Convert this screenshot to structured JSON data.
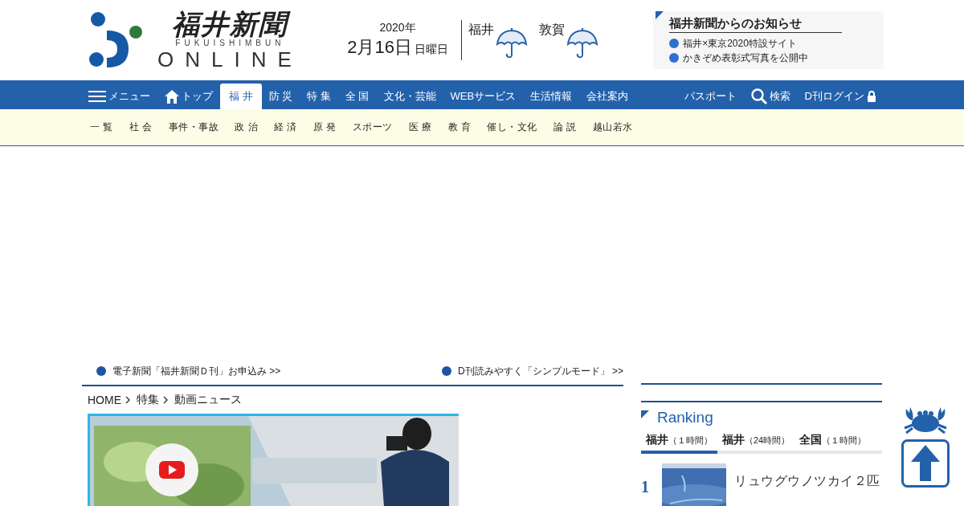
{
  "logo": {
    "title": "福井新聞",
    "subtitle": "FUKUISHIMBUN",
    "wordmark": "ONLINE"
  },
  "date": {
    "year": "2020年",
    "day": "2月16日",
    "weekday": "日曜日"
  },
  "weather": [
    {
      "city": "福井",
      "kind": "rain"
    },
    {
      "city": "敦賀",
      "kind": "rain"
    }
  ],
  "notices": {
    "title": "福井新聞からのお知らせ",
    "items": [
      "福井×東京2020特設サイト",
      "かきぞめ表彰式写真を公開中"
    ]
  },
  "nav": {
    "menu": "メニュー",
    "items": [
      {
        "label": "トップ",
        "kind": "home",
        "selected": false
      },
      {
        "label": "福 井",
        "kind": "text",
        "selected": true
      },
      {
        "label": "防 災",
        "kind": "text",
        "selected": false
      },
      {
        "label": "特 集",
        "kind": "text",
        "selected": false
      },
      {
        "label": "全 国",
        "kind": "text",
        "selected": false
      },
      {
        "label": "文化・芸能",
        "kind": "text",
        "selected": false
      },
      {
        "label": "WEBサービス",
        "kind": "text",
        "selected": false
      },
      {
        "label": "生活情報",
        "kind": "text",
        "selected": false
      },
      {
        "label": "会社案内",
        "kind": "text",
        "selected": false
      }
    ],
    "right": [
      {
        "label": "パスポート",
        "kind": "text"
      },
      {
        "label": "検索",
        "kind": "search"
      },
      {
        "label": "D刊ログイン",
        "kind": "lock"
      }
    ]
  },
  "subnav": [
    "一 覧",
    "社 会",
    "事件・事故",
    "政 治",
    "経 済",
    "原 発",
    "スポーツ",
    "医 療",
    "教 育",
    "催し・文化",
    "論 説",
    "越山若水"
  ],
  "promo_links": [
    "電子新聞「福井新聞Ｄ刊」お申込み >>",
    "D刊読みやすく「シンプルモード」 >>"
  ],
  "breadcrumb": [
    "HOME",
    "特集",
    "動画ニュース"
  ],
  "ranking": {
    "title": "Ranking",
    "tabs": [
      {
        "label": "福井",
        "period": "（１時間）",
        "selected": true
      },
      {
        "label": "福井",
        "period": "（24時間）",
        "selected": false
      },
      {
        "label": "全国",
        "period": "（１時間）",
        "selected": false
      }
    ],
    "items": [
      {
        "rank": "1",
        "title": "リュウグウノツカイ２匹"
      }
    ]
  }
}
